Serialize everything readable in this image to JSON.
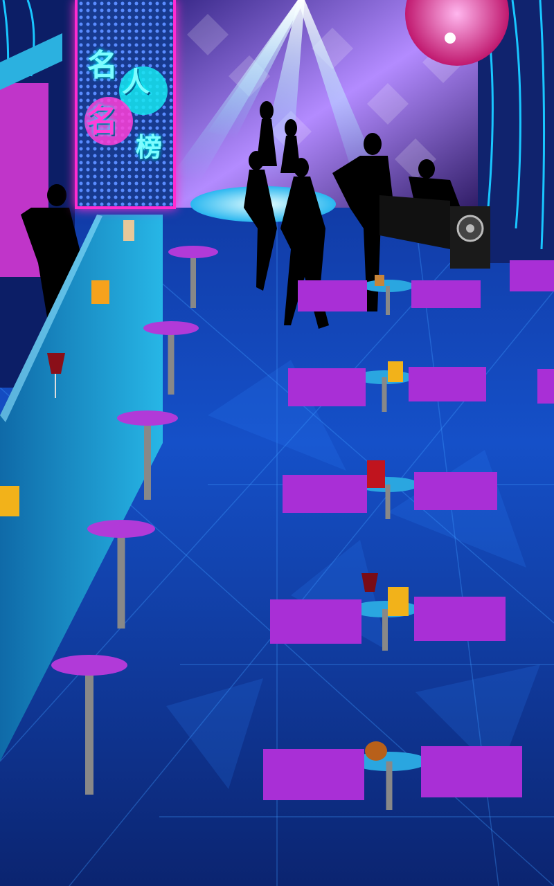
{
  "sign": {
    "title_chars": [
      "名",
      "人",
      "名",
      "榜"
    ]
  },
  "palette": {
    "floor_dark": "#0a1f6e",
    "floor_light": "#1d6fe0",
    "bar_counter": "#1aa3d6",
    "stool_top": "#b13ad8",
    "chair": "#a92fd6",
    "table": "#2aa6e0",
    "neon_pink": "#ff2bd0",
    "neon_cyan": "#16e6f0"
  },
  "icons": [
    "disco-ball-icon",
    "speaker-icon",
    "beer-mug-icon",
    "wine-glass-icon",
    "cocktail-icon",
    "cognac-glass-icon",
    "whisky-glass-icon"
  ]
}
